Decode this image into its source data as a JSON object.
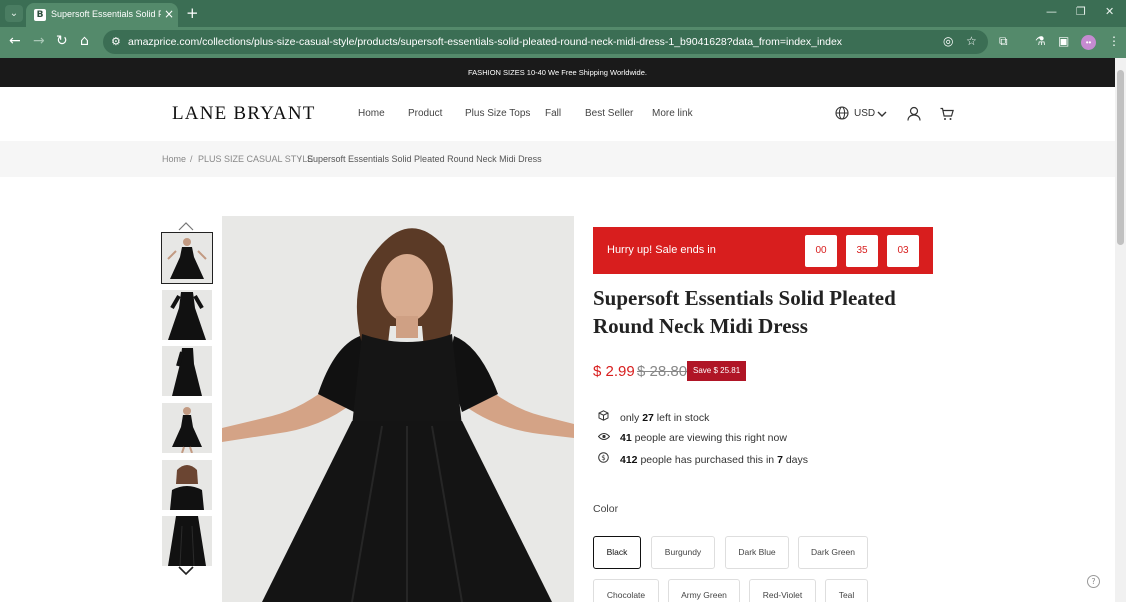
{
  "browser": {
    "tab_title": "Supersoft Essentials Solid Pleated",
    "favicon_letter": "B",
    "url": "amazprice.com/collections/plus-size-casual-style/products/supersoft-essentials-solid-pleated-round-neck-midi-dress-1_b9041628?data_from=index_index",
    "profile_initials": "••"
  },
  "announcement": "FASHION SIZES 10-40 We Free Shipping Worldwide.",
  "header": {
    "logo": "LANE BRYANT",
    "nav": [
      "Home",
      "Product",
      "Plus Size Tops",
      "Fall",
      "Best Seller",
      "More link"
    ],
    "currency": "USD"
  },
  "breadcrumb": {
    "home": "Home",
    "sep": "/",
    "category": "PLUS SIZE CASUAL STYLE",
    "current": "Supersoft Essentials Solid Pleated Round Neck Midi Dress"
  },
  "product": {
    "sale_text": "Hurry up!  Sale ends in",
    "countdown": [
      "00",
      "35",
      "03"
    ],
    "title": "Supersoft Essentials Solid Pleated Round Neck Midi Dress",
    "price": "$ 2.99",
    "old_price": "$ 28.80",
    "save_badge": "Save $ 25.81",
    "stock": {
      "pre": "only",
      "num": "27",
      "post": "left in stock"
    },
    "viewing": {
      "num": "41",
      "post": "people are viewing this right now"
    },
    "purchased": {
      "num": "412",
      "mid": "people has purchased this in",
      "days": "7",
      "post": "days"
    },
    "color_label": "Color",
    "colors": [
      "Black",
      "Burgundy",
      "Dark Blue",
      "Dark Green",
      "Chocolate",
      "Army Green",
      "Red-Violet",
      "Teal"
    ],
    "selected_color": "Black"
  },
  "colors": {
    "browser_dark": "#3b6e54",
    "browser_light": "#548a6b",
    "sale_red": "#d81e1e",
    "badge_red": "#b01526",
    "announce_bg": "#1a1a1a"
  }
}
